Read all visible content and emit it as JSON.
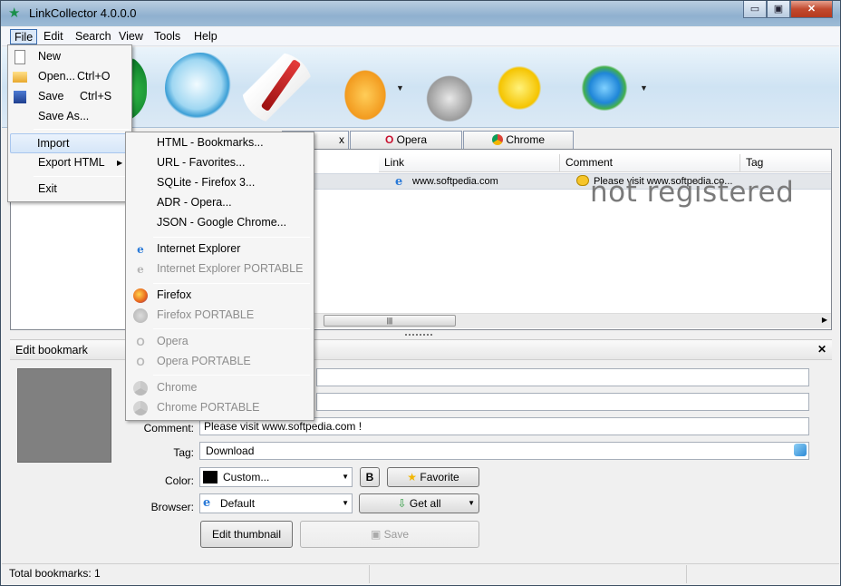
{
  "window": {
    "title": "LinkCollector 4.0.0.0",
    "min": "▭",
    "max": "▣",
    "close": "✕"
  },
  "menubar": [
    "File",
    "Edit",
    "Search",
    "View",
    "Tools",
    "Help"
  ],
  "file_menu": {
    "new": "New",
    "open": "Open...",
    "open_shortcut": "Ctrl+O",
    "save": "Save",
    "save_shortcut": "Ctrl+S",
    "save_as": "Save As...",
    "import": "Import",
    "export_html": "Export HTML",
    "exit": "Exit"
  },
  "import_submenu": {
    "html": "HTML - Bookmarks...",
    "url": "URL - Favorites...",
    "sqlite": "SQLite - Firefox 3...",
    "adr": "ADR - Opera...",
    "json": "JSON - Google Chrome...",
    "ie": "Internet Explorer",
    "ie_portable": "Internet Explorer PORTABLE",
    "firefox": "Firefox",
    "firefox_portable": "Firefox PORTABLE",
    "opera": "Opera",
    "opera_portable": "Opera PORTABLE",
    "chrome": "Chrome",
    "chrome_portable": "Chrome PORTABLE"
  },
  "tabs": {
    "partial": "x",
    "opera": "Opera",
    "chrome": "Chrome"
  },
  "columns": {
    "link": "Link",
    "comment": "Comment",
    "tag": "Tag"
  },
  "rows": [
    {
      "link": "www.softpedia.com",
      "comment": "Please visit www.softpedia.co..."
    }
  ],
  "watermark": "not registered",
  "scroll_grip": "|||",
  "edit": {
    "header": "Edit bookmark",
    "close": "✕",
    "comment_label": "Comment:",
    "comment_value": "Please visit www.softpedia.com !",
    "tag_label": "Tag:",
    "tag_value": "Download",
    "color_label": "Color:",
    "color_value": "Custom...",
    "bold_button": "B",
    "favorite_button": "Favorite",
    "browser_label": "Browser:",
    "browser_value": "Default",
    "getall_button": "Get all",
    "thumbnail_button": "Edit thumbnail",
    "save_button": "Save"
  },
  "status": {
    "total": "Total bookmarks: 1"
  },
  "colors": {
    "accent": "#3c6fb0",
    "thumbnail": "#808080",
    "watermark": "#7a7a7a"
  }
}
